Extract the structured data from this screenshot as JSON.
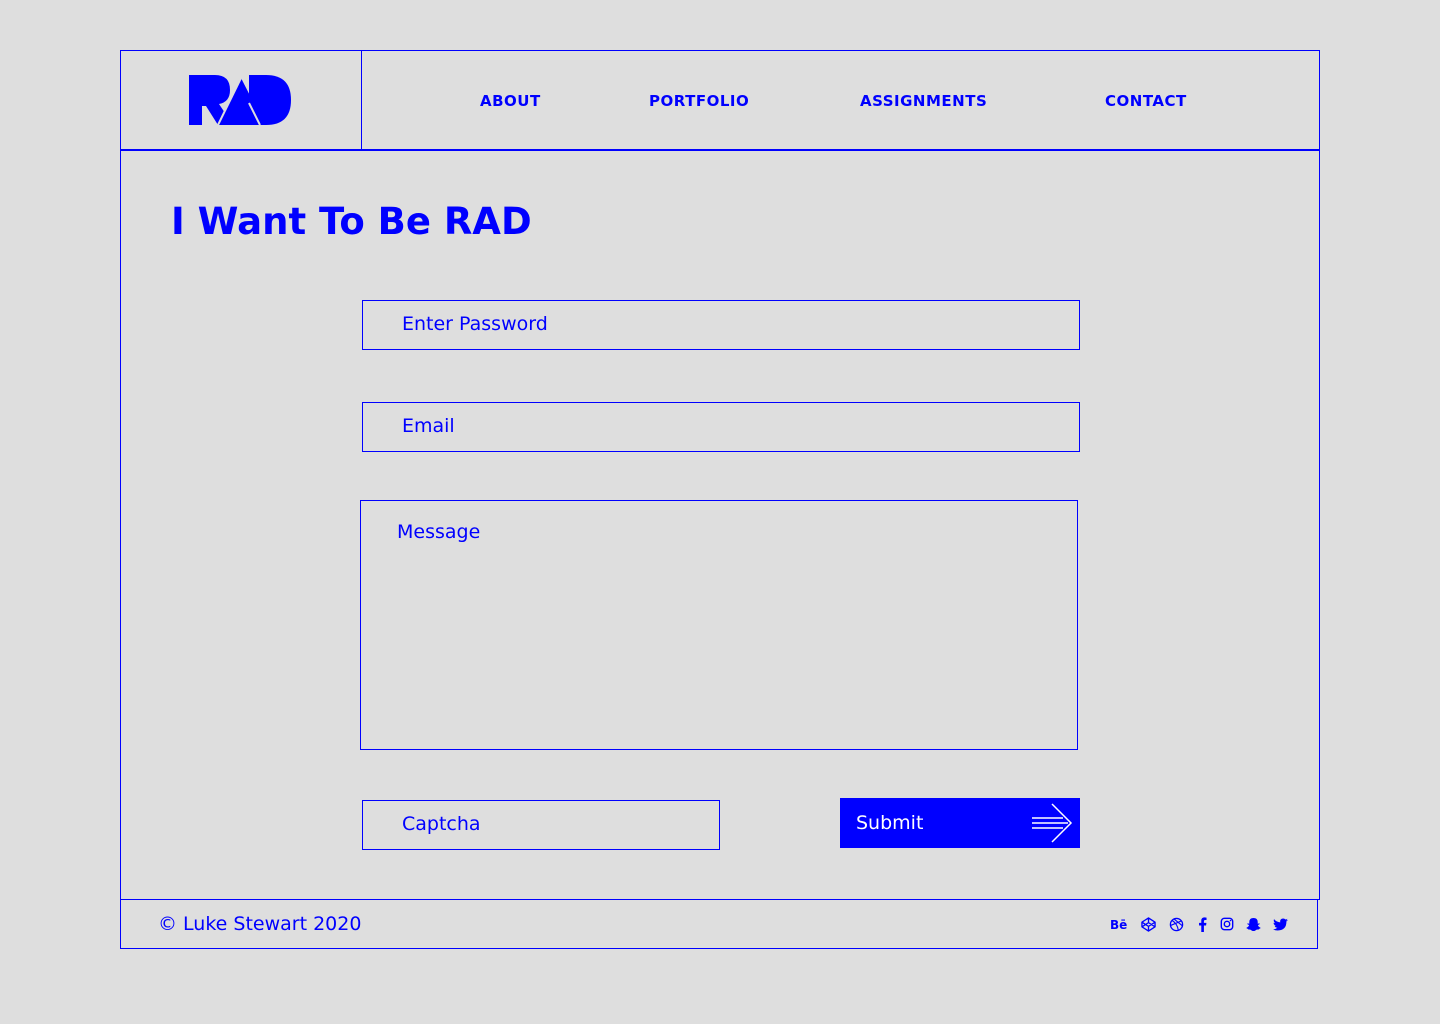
{
  "brand": {
    "logo_text": "RAD"
  },
  "nav": {
    "items": [
      {
        "label": "ABOUT"
      },
      {
        "label": "PORTFOLIO"
      },
      {
        "label": "ASSIGNMENTS"
      },
      {
        "label": "CONTACT"
      }
    ]
  },
  "main": {
    "title": "I Want To Be RAD"
  },
  "form": {
    "password_placeholder": "Enter Password",
    "email_placeholder": "Email",
    "message_placeholder": "Message",
    "captcha_placeholder": "Captcha",
    "submit_label": "Submit"
  },
  "footer": {
    "copyright": "© Luke Stewart 2020",
    "social_icons": [
      "behance-icon",
      "codepen-icon",
      "dribbble-icon",
      "facebook-icon",
      "instagram-icon",
      "snapchat-icon",
      "twitter-icon"
    ]
  },
  "colors": {
    "accent": "#0000ff",
    "background": "#dedede",
    "button_text": "#ffffff"
  }
}
